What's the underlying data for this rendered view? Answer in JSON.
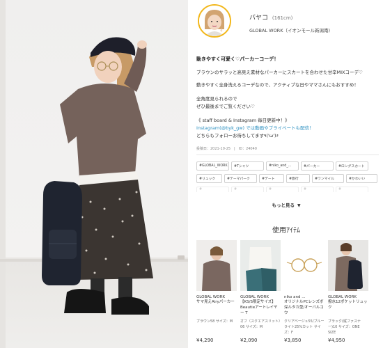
{
  "staff": {
    "name": "バヤコ",
    "height": "(161cm)",
    "shop": "GLOBAL WORK（イオンモール新潟南)"
  },
  "post": {
    "title": "動きやすく可愛く♡パーカーコーデ！",
    "lines": [
      "ブラウンのサラッと高見え素材なパーカーにスカートを合わせた甘辛MIXコーデ♡",
      "動きやすく全身洗えるコーデなので、アクティブな日やママさんにもおすすめ！",
      "全角度見られるので",
      "ぜひ最後までご覧ください♡"
    ],
    "staff_board": "《 staff board & Instagram 毎日更新中！》",
    "instagram": "Instagram(@byk_gw) では動画やプライベートも配信！",
    "follow": "どちらもフォローお待ちしてます٩('ω')۶",
    "meta": "投稿日：2021-10-25　|　ID：24040"
  },
  "tags_row1": [
    "#GLOBAL_WORK",
    "#Tシャツ",
    "#niko_and_...",
    "#パーカー",
    "#ロングスカート"
  ],
  "tags_row2": [
    "#リュック",
    "#テーマパーク",
    "#デート",
    "#旅行",
    "#ワンマイル",
    "#かわいい"
  ],
  "tags_row3": [
    "#",
    "#",
    "#",
    "#",
    "#"
  ],
  "more_label": "もっと見る",
  "used_items_title": "使用ｱｲﾃﾑ",
  "items": [
    {
      "brand": "GLOBAL WORK",
      "name": "サマ見えAiryパーカー",
      "detail": "ブラウン58 サイズ：M",
      "price": "¥4,290"
    },
    {
      "brand": "GLOBAL WORK",
      "name": "【KS/S限定サイズ】Beautieアートレイヤー T",
      "detail": "オフ（スクエアスリット）06 サイズ：M",
      "price": "¥2,090"
    },
    {
      "brand": "niko and ...",
      "name": "オリジナルPCレンズボ 深ルタカ型/オーバルコウ",
      "detail": "クリアベージュ55/ブルーライト25%カット サイズ：F",
      "price": "¥3,850"
    },
    {
      "brand": "GLOBAL WORK",
      "name": "撥水12ポケットリュック",
      "detail": "ブラック(縦ファスナー)10 サイズ：ONE SIZE",
      "price": "¥4,950"
    }
  ]
}
